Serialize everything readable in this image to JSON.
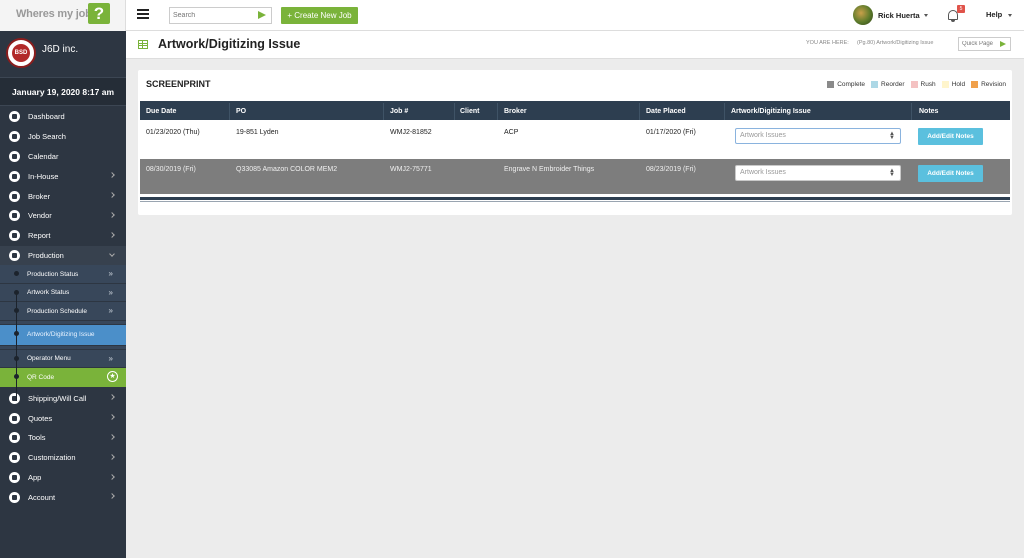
{
  "app": {
    "logo_text": "Wheres my job",
    "logo_mark": "?"
  },
  "topbar": {
    "search_placeholder": "Search",
    "create_label": "+ Create New Job",
    "user_name": "Rick Huerta",
    "notification_count": "5",
    "help_label": "Help"
  },
  "brand": {
    "badge_text": "BSD",
    "name": "J6D inc."
  },
  "date_display": "January 19, 2020 8:17 am",
  "sidebar": {
    "items": [
      {
        "label": "Dashboard"
      },
      {
        "label": "Job Search"
      },
      {
        "label": "Calendar"
      },
      {
        "label": "In-House"
      },
      {
        "label": "Broker"
      },
      {
        "label": "Vendor"
      },
      {
        "label": "Report"
      },
      {
        "label": "Production"
      }
    ],
    "production_sub": [
      {
        "label": "Production Status"
      },
      {
        "label": "Artwork Status"
      },
      {
        "label": "Production Schedule"
      },
      {
        "label": "Artwork/Digitizing Issue"
      },
      {
        "label": "Operator Menu"
      },
      {
        "label": "QR Code"
      }
    ],
    "items_after": [
      {
        "label": "Shipping/Will Call"
      },
      {
        "label": "Quotes"
      },
      {
        "label": "Tools"
      },
      {
        "label": "Customization"
      },
      {
        "label": "App"
      },
      {
        "label": "Account"
      }
    ]
  },
  "page": {
    "title": "Artwork/Digitizing Issue",
    "breadcrumb_label": "YOU ARE HERE:",
    "breadcrumb": "(Pg.80) Artwork/Digitizing Issue",
    "quick_page_placeholder": "Quick Page"
  },
  "panel": {
    "title": "SCREENPRINT",
    "legend": [
      {
        "label": "Complete",
        "color": "#8a8a8a"
      },
      {
        "label": "Reorder",
        "color": "#add8e6"
      },
      {
        "label": "Rush",
        "color": "#f4c2c2"
      },
      {
        "label": "Hold",
        "color": "#fff5cc"
      },
      {
        "label": "Revision",
        "color": "#f0a04b"
      }
    ],
    "columns": [
      "Due Date",
      "PO",
      "Job #",
      "Client",
      "Broker",
      "Date Placed",
      "Artwork/Digitizing Issue",
      "Notes"
    ],
    "rows": [
      {
        "due_date": "01/23/2020 (Thu)",
        "po": "19-851 Lyden",
        "job": "WMJ2-81852",
        "client": "",
        "broker": "ACP",
        "date_placed": "01/17/2020 (Fri)",
        "issue": "Artwork Issues",
        "notes_label": "Add/Edit Notes"
      },
      {
        "due_date": "08/30/2019 (Fri)",
        "po": "Q33085 Amazon COLOR MEM2",
        "job": "WMJ2-75771",
        "client": "",
        "broker": "Engrave N Embroider Things",
        "date_placed": "08/23/2019 (Fri)",
        "issue": "Artwork Issues",
        "notes_label": "Add/Edit Notes"
      }
    ]
  }
}
